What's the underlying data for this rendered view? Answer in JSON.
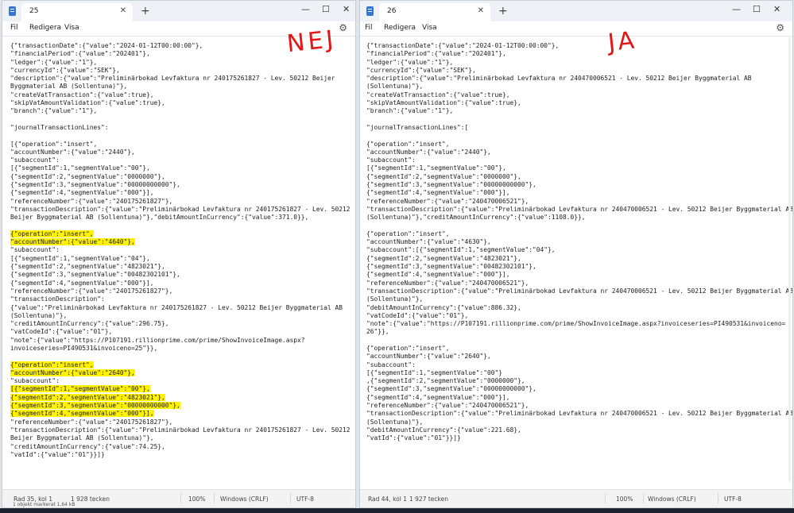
{
  "left": {
    "tab_title": "25",
    "menu": [
      "Fil",
      "Redigera",
      "Visa"
    ],
    "annotation": "NEJ",
    "lines": [
      "{\"transactionDate\":{\"value\":\"2024-01-12T00:00:00\"},",
      "\"financialPeriod\":{\"value\":\"202401\"},",
      "\"ledger\":{\"value\":\"1\"},",
      "\"currencyId\":{\"value\":\"SEK\"},",
      "\"description\":{\"value\":\"Preliminärbokad Levfaktura nr 240175261827 - Lev. 50212 Beijer",
      "Byggmaterial AB (Sollentuna)\"},",
      "\"createVatTransaction\":{\"value\":true},",
      "\"skipVatAmountValidation\":{\"value\":true},",
      "\"branch\":{\"value\":\"1\"},",
      "",
      "\"journalTransactionLines\":",
      "",
      "[{\"operation\":\"insert\",",
      "\"accountNumber\":{\"value\":\"2440\"},",
      "\"subaccount\":",
      "[{\"segmentId\":1,\"segmentValue\":\"00\"},",
      "{\"segmentId\":2,\"segmentValue\":\"0000000\"},",
      "{\"segmentId\":3,\"segmentValue\":\"00000000000\"},",
      "{\"segmentId\":4,\"segmentValue\":\"000\"}],",
      "\"referenceNumber\":{\"value\":\"240175261827\"},",
      "\"transactionDescription\":{\"value\":\"Preliminärbokad Levfaktura nr 240175261827 - Lev. 50212",
      "Beijer Byggmaterial AB (Sollentuna)\"},\"debitAmountInCurrency\":{\"value\":371.0}},",
      "",
      "{\"operation\":\"insert\",",
      "\"accountNumber\":{\"value\":\"4640\"},",
      "\"subaccount\":",
      "[{\"segmentId\":1,\"segmentValue\":\"04\"},",
      "{\"segmentId\":2,\"segmentValue\":\"4823021\"},",
      "{\"segmentId\":3,\"segmentValue\":\"00482302101\"},",
      "{\"segmentId\":4,\"segmentValue\":\"000\"}],",
      "\"referenceNumber\":{\"value\":\"240175261827\"},",
      "\"transactionDescription\":",
      "{\"value\":\"Preliminärbokad Levfaktura nr 240175261827 - Lev. 50212 Beijer Byggmaterial AB",
      "(Sollentuna)\"},",
      "\"creditAmountInCurrency\":{\"value\":296.75},",
      "\"vatCodeId\":{\"value\":\"01\"},",
      "\"note\":{\"value\":\"https://P107191.rillionprime.com/prime/ShowInvoiceImage.aspx?",
      "invoiceseries=PI490531&invoiceno=25\"}},",
      "",
      "{\"operation\":\"insert\",",
      "\"accountNumber\":{\"value\":\"2640\"},",
      "\"subaccount\":",
      "[{\"segmentId\":1,\"segmentValue\":\"00\"},",
      "{\"segmentId\":2,\"segmentValue\":\"4823021\"},",
      "{\"segmentId\":3,\"segmentValue\":\"00000000000\"},",
      "{\"segmentId\":4,\"segmentValue\":\"000\"}],",
      "\"referenceNumber\":{\"value\":\"240175261827\"},",
      "\"transactionDescription\":{\"value\":\"Preliminärbokad Levfaktura nr 240175261827 - Lev. 50212",
      "Beijer Byggmaterial AB (Sollentuna)\"},",
      "\"creditAmountInCurrency\":{\"value\":74.25},",
      "\"vatId\":{\"value\":\"01\"}}]}"
    ],
    "highlighted_lines": [
      23,
      24,
      39,
      40,
      42,
      43,
      44,
      45
    ],
    "status": {
      "position": "Rad 35, kol 1",
      "chars": "1 928 tecken",
      "zoom": "100%",
      "eol": "Windows (CRLF)",
      "encoding": "UTF-8"
    }
  },
  "right": {
    "tab_title": "26",
    "menu": [
      "Fil",
      "Redigera",
      "Visa"
    ],
    "annotation": "JA",
    "lines": [
      "{\"transactionDate\":{\"value\":\"2024-01-12T00:00:00\"},",
      "\"financialPeriod\":{\"value\":\"202401\"},",
      "\"ledger\":{\"value\":\"1\"},",
      "\"currencyId\":{\"value\":\"SEK\"},",
      "\"description\":{\"value\":\"Preliminärbokad Levfaktura nr 240470006521 - Lev. 50212 Beijer Byggmaterial AB",
      "(Sollentuna)\"},",
      "\"createVatTransaction\":{\"value\":true},",
      "\"skipVatAmountValidation\":{\"value\":true},",
      "\"branch\":{\"value\":\"1\"},",
      "",
      "\"journalTransactionLines\":[",
      "",
      "{\"operation\":\"insert\",",
      "\"accountNumber\":{\"value\":\"2440\"},",
      "\"subaccount\":",
      "[{\"segmentId\":1,\"segmentValue\":\"00\"},",
      "{\"segmentId\":2,\"segmentValue\":\"0000000\"},",
      "{\"segmentId\":3,\"segmentValue\":\"00000000000\"},",
      "{\"segmentId\":4,\"segmentValue\":\"000\"}],",
      "\"referenceNumber\":{\"value\":\"240470006521\"},",
      "\"transactionDescription\":{\"value\":\"Preliminärbokad Levfaktura nr 240470006521 - Lev. 50212 Beijer Byggmaterial AB",
      "(Sollentuna)\"},\"creditAmountInCurrency\":{\"value\":1108.0}},",
      "",
      "{\"operation\":\"insert\",",
      "\"accountNumber\":{\"value\":\"4630\"},",
      "\"subaccount\":[{\"segmentId\":1,\"segmentValue\":\"04\"},",
      "{\"segmentId\":2,\"segmentValue\":\"4823021\"},",
      "{\"segmentId\":3,\"segmentValue\":\"00482302101\"},",
      "{\"segmentId\":4,\"segmentValue\":\"000\"}],",
      "\"referenceNumber\":{\"value\":\"240470006521\"},",
      "\"transactionDescription\":{\"value\":\"Preliminärbokad Levfaktura nr 240470006521 - Lev. 50212 Beijer Byggmaterial AB",
      "(Sollentuna)\"},",
      "\"debitAmountInCurrency\":{\"value\":886.32},",
      "\"vatCodeId\":{\"value\":\"01\"},",
      "\"note\":{\"value\":\"https://P107191.rillionprime.com/prime/ShowInvoiceImage.aspx?invoiceseries=PI490531&invoiceno=",
      "26\"}},",
      "",
      "{\"operation\":\"insert\",",
      "\"accountNumber\":{\"value\":\"2640\"},",
      "\"subaccount\":",
      "[{\"segmentId\":1,\"segmentValue\":\"00\"}",
      ",{\"segmentId\":2,\"segmentValue\":\"0000000\"},",
      "{\"segmentId\":3,\"segmentValue\":\"00000000000\"},",
      "{\"segmentId\":4,\"segmentValue\":\"000\"}],",
      "\"referenceNumber\":{\"value\":\"240470006521\"},",
      "\"transactionDescription\":{\"value\":\"Preliminärbokad Levfaktura nr 240470006521 - Lev. 50212 Beijer Byggmaterial AB",
      "(Sollentuna)\"},",
      "\"debitAmountInCurrency\":{\"value\":221.68},",
      "\"vatId\":{\"value\":\"01\"}}]}"
    ],
    "highlighted_lines": [],
    "status": {
      "position": "Rad 44, kol 1",
      "chars": "1 927 tecken",
      "zoom": "100%",
      "eol": "Windows (CRLF)",
      "encoding": "UTF-8"
    }
  },
  "highlight_color": "#fff200",
  "annotation_color": "#e51515",
  "taskbar_text": "1 objekt markerat  1,64 kB"
}
